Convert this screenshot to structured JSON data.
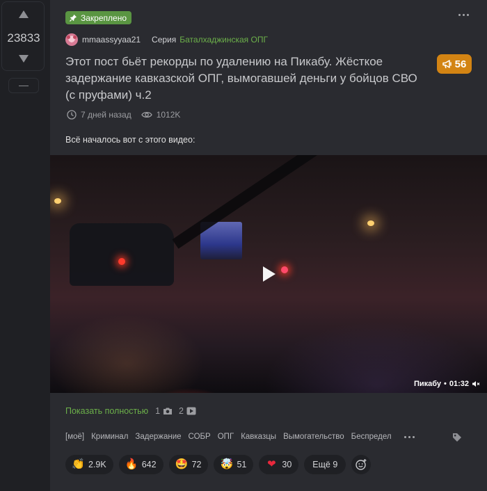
{
  "vote": {
    "count": "23833",
    "minus": "—"
  },
  "post": {
    "pinned_label": "Закреплено",
    "author": "mmaassyyaa21",
    "series_label": "Серия",
    "series_name": "Баталхаджинская ОПГ",
    "title": "Этот пост бьёт рекорды по удалению на Пикабу. Жёсткое задержание кавказской ОПГ, вымогавшей деньги у бойцов СВО (с пруфами) ч.2",
    "comments_count": "56",
    "time_ago": "7 дней назад",
    "views": "1012K",
    "intro_text": "Всё началось вот с этого видео:",
    "video": {
      "source": "Пикабу",
      "duration": "01:32",
      "separator": "•"
    },
    "show_more": "Показать полностью",
    "photos_count": "1",
    "videos_count": "2",
    "tags": [
      "[моё]",
      "Криминал",
      "Задержание",
      "СОБР",
      "ОПГ",
      "Кавказцы",
      "Вымогательство",
      "Беспредел"
    ],
    "reactions": [
      {
        "icon": "clap-icon",
        "glyph": "👏",
        "count": "2.9K"
      },
      {
        "icon": "fire-icon",
        "glyph": "🔥",
        "count": "642"
      },
      {
        "icon": "star-eyes-icon",
        "glyph": "🤩",
        "count": "72"
      },
      {
        "icon": "mind-blown-icon",
        "glyph": "🤯",
        "count": "51"
      },
      {
        "icon": "heart-icon",
        "glyph": "❤",
        "count": "30"
      }
    ],
    "more_reactions": "Ещё 9"
  },
  "colors": {
    "accent_green": "#6cb04a",
    "pinned_bg": "#5a9542",
    "comments_bg": "#d38413",
    "card_bg": "#2a2b30",
    "page_bg": "#1f2024"
  }
}
